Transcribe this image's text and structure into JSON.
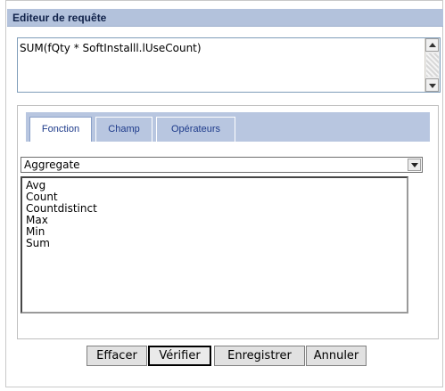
{
  "header": {
    "title": "Editeur de requête"
  },
  "editor": {
    "value": "SUM(fQty * SoftInstalll.lUseCount)"
  },
  "tabs": [
    {
      "label": "Fonction",
      "active": true
    },
    {
      "label": "Champ",
      "active": false
    },
    {
      "label": "Opérateurs",
      "active": false
    }
  ],
  "function_tab": {
    "category_select": {
      "selected": "Aggregate"
    },
    "functions": [
      "Avg",
      "Count",
      "Countdistinct",
      "Max",
      "Min",
      "Sum"
    ]
  },
  "buttons": {
    "clear": "Effacer",
    "verify": "Vérifier",
    "save": "Enregistrer",
    "cancel": "Annuler"
  },
  "colors": {
    "header_bg": "#b3c2dc",
    "tab_bar_bg": "#b8c6e0",
    "tab_text": "#1d3a8a"
  }
}
